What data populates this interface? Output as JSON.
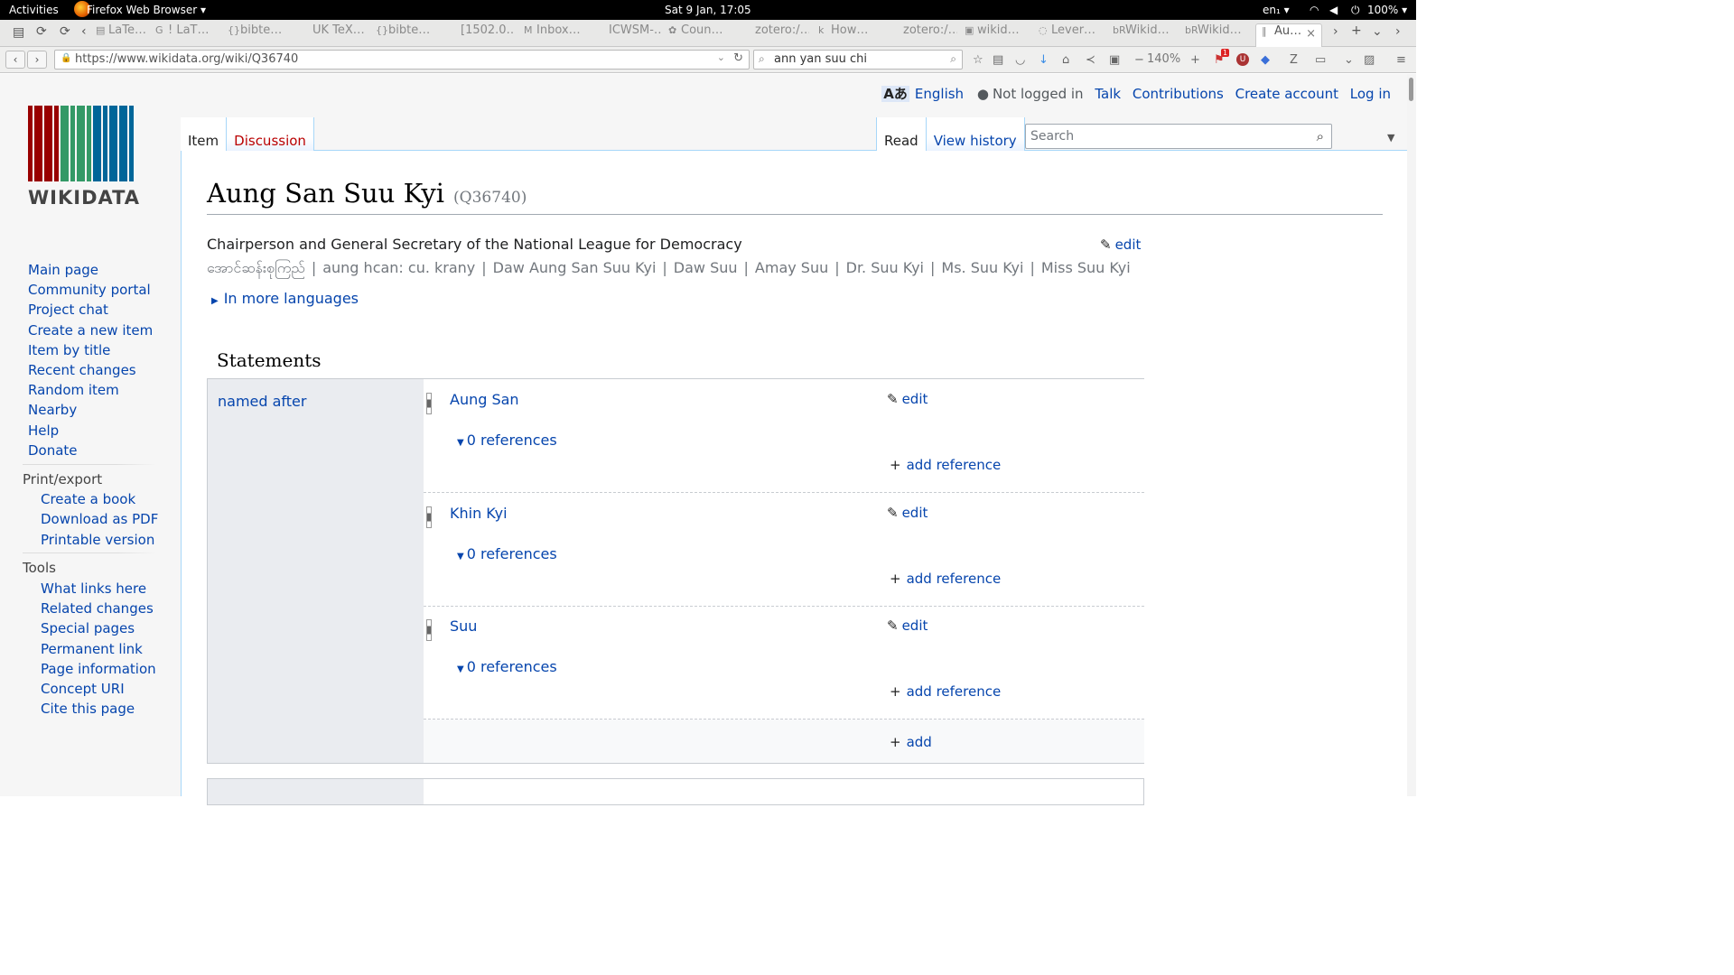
{
  "topbar": {
    "activities": "Activities",
    "app_menu": "Firefox Web Browser ▾",
    "clock": "Sat  9 Jan, 17:05",
    "keyboard": "en₁ ▾",
    "battery": "100% ▾"
  },
  "browser": {
    "tabs": [
      {
        "icon": "latex-icon",
        "label": "LaTe…"
      },
      {
        "icon": "google-icon",
        "label": "! LaT…"
      },
      {
        "icon": "json-icon",
        "label": "bibte…"
      },
      {
        "icon": "blank-icon",
        "label": "UK TeX…"
      },
      {
        "icon": "json-icon",
        "label": "bibte…"
      },
      {
        "icon": "blank-icon",
        "label": "[1502.0…"
      },
      {
        "icon": "gmail-icon",
        "label": "Inbox…"
      },
      {
        "icon": "blank-icon",
        "label": "ICWSM-…"
      },
      {
        "icon": "globe-icon",
        "label": "Coun…"
      },
      {
        "icon": "blank-icon",
        "label": "zotero:/…"
      },
      {
        "icon": "k-icon",
        "label": "How…"
      },
      {
        "icon": "blank-icon",
        "label": "zotero:/…"
      },
      {
        "icon": "wiki-icon",
        "label": "wikid…"
      },
      {
        "icon": "lever-icon",
        "label": "Lever…"
      },
      {
        "icon": "br-icon",
        "label": "Wikid…"
      },
      {
        "icon": "br-icon",
        "label": "Wikid…"
      },
      {
        "icon": "wikidata-icon",
        "label": "Au…"
      }
    ],
    "url": "https://www.wikidata.org/wiki/Q36740",
    "search_query": "ann yan suu chi",
    "zoom": "140%",
    "badge_count": "1"
  },
  "personal": {
    "language": "English",
    "not_logged_in": "Not logged in",
    "talk": "Talk",
    "contributions": "Contributions",
    "create_account": "Create account",
    "log_in": "Log in"
  },
  "logo": {
    "wordmark": "WIKIDATA"
  },
  "sidebar": {
    "nav": [
      "Main page",
      "Community portal",
      "Project chat",
      "Create a new item",
      "Item by title",
      "Recent changes",
      "Random item",
      "Nearby",
      "Help",
      "Donate"
    ],
    "print_heading": "Print/export",
    "print": [
      "Create a book",
      "Download as PDF",
      "Printable version"
    ],
    "tools_heading": "Tools",
    "tools": [
      "What links here",
      "Related changes",
      "Special pages",
      "Permanent link",
      "Page information",
      "Concept URI",
      "Cite this page"
    ]
  },
  "page_tabs": {
    "item": "Item",
    "discussion": "Discussion",
    "read": "Read",
    "view_history": "View history",
    "search_placeholder": "Search"
  },
  "entity": {
    "label": "Aung San Suu Kyi",
    "id": "(Q36740)",
    "description": "Chairperson and General Secretary of the National League for Democracy",
    "edit": "edit",
    "aliases": [
      "အောင်ဆန်းစုကြည်",
      "aung hcan: cu. krany",
      "Daw Aung San Suu Kyi",
      "Daw Suu",
      "Amay Suu",
      "Dr. Suu Kyi",
      "Ms. Suu Kyi",
      "Miss Suu Kyi"
    ],
    "more_languages": "In more languages"
  },
  "statements": {
    "heading": "Statements",
    "property": "named after",
    "values": [
      {
        "value": "Aung San",
        "edit": "edit",
        "references": "0 references",
        "add_reference": "add reference"
      },
      {
        "value": "Khin Kyi",
        "edit": "edit",
        "references": "0 references",
        "add_reference": "add reference"
      },
      {
        "value": "Suu",
        "edit": "edit",
        "references": "0 references",
        "add_reference": "add reference"
      }
    ],
    "add": "add"
  }
}
